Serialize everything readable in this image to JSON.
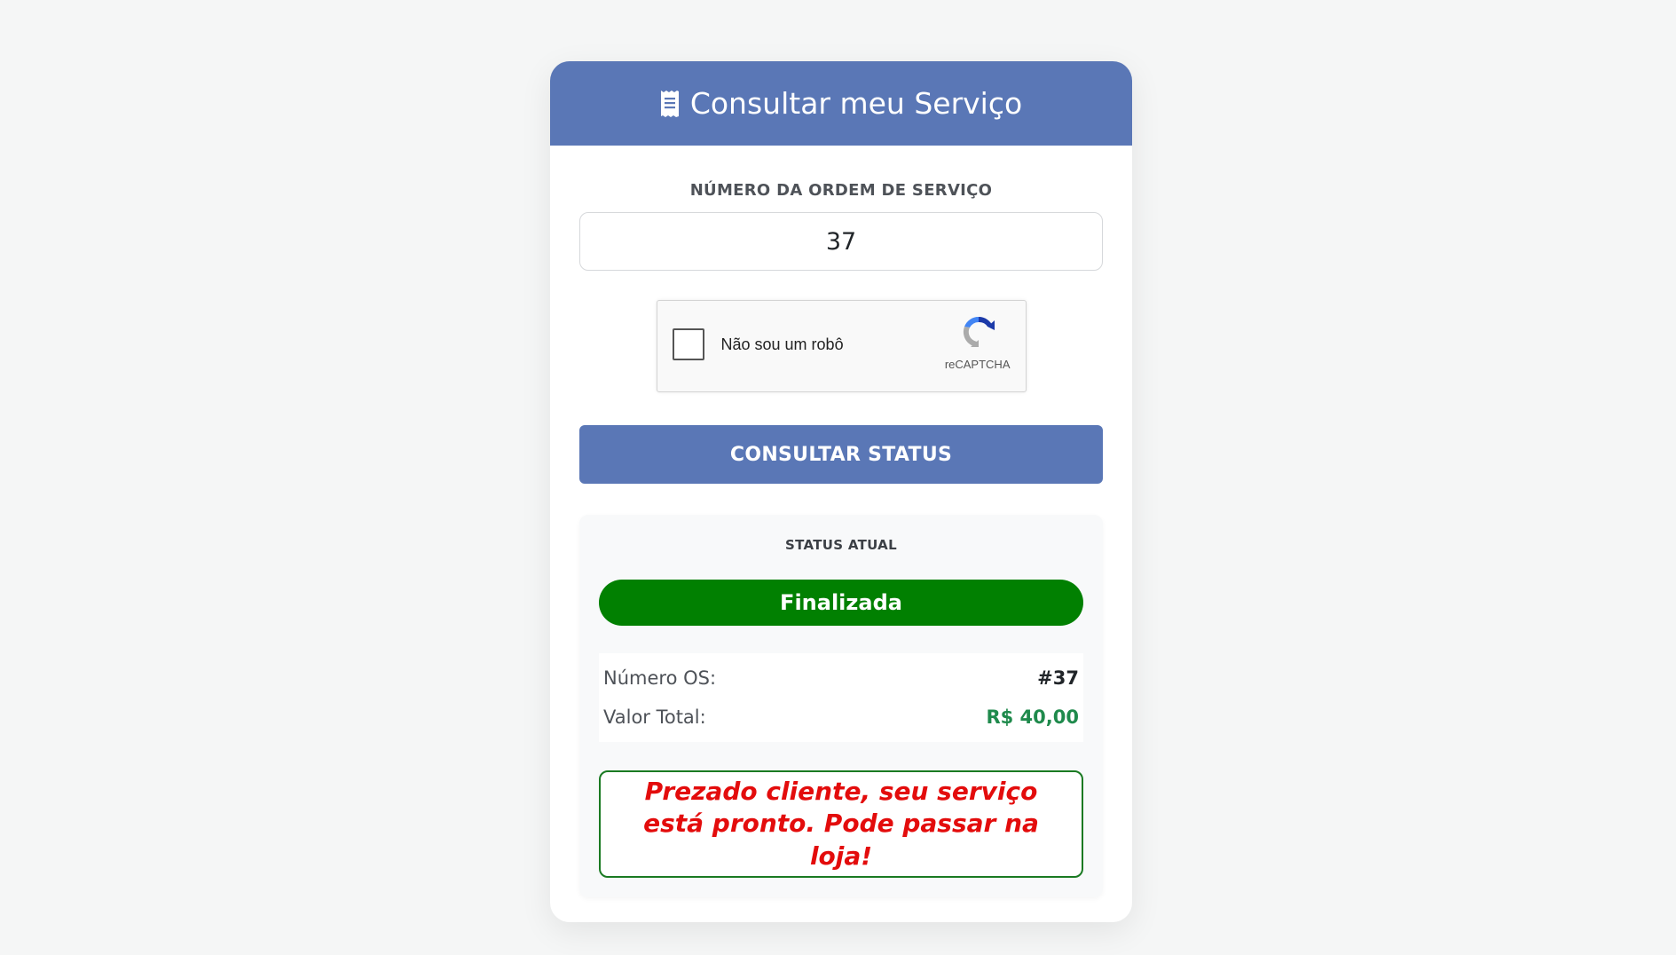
{
  "header": {
    "icon": "receipt-icon",
    "title": "Consultar meu Serviço",
    "color": "#5a77b6"
  },
  "form": {
    "os_label": "NÚMERO DA ORDEM DE SERVIÇO",
    "os_value": "37",
    "recaptcha": {
      "label": "Não sou um robô",
      "brand": "reCAPTCHA",
      "checked": false,
      "icon": "recaptcha-logo-icon"
    },
    "submit_label": "CONSULTAR STATUS"
  },
  "status": {
    "label": "STATUS ATUAL",
    "value": "Finalizada",
    "color": "#018001",
    "rows": [
      {
        "key": "Número OS:",
        "value": "#37"
      },
      {
        "key": "Valor Total:",
        "value": "R$ 40,00",
        "color": "#1f8a4c"
      }
    ],
    "message": "Prezado cliente, seu serviço está pronto. Pode passar na loja!",
    "message_color": "#e30c0c"
  }
}
